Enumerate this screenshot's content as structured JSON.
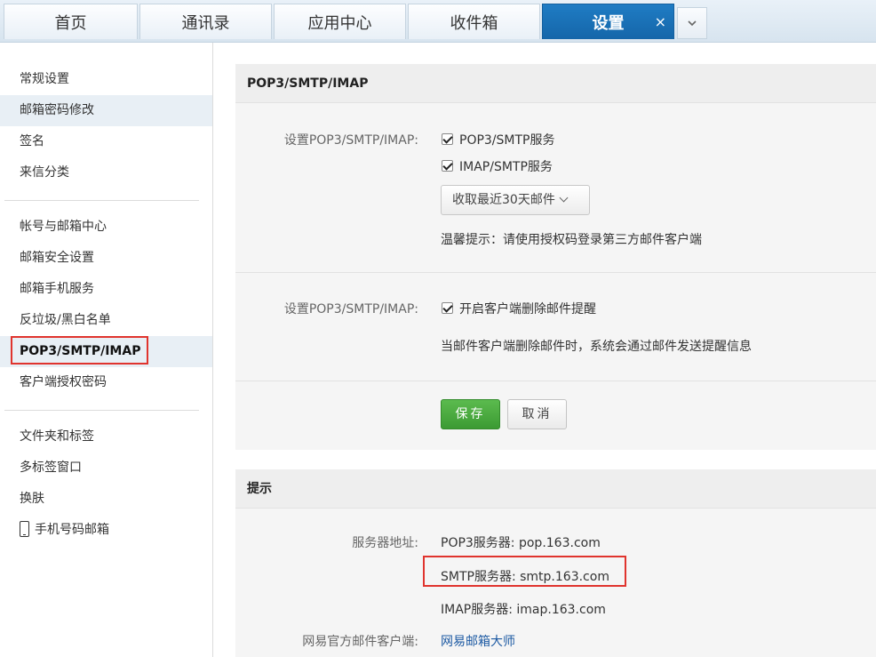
{
  "tabs": [
    {
      "label": "首页"
    },
    {
      "label": "通讯录"
    },
    {
      "label": "应用中心"
    },
    {
      "label": "收件箱"
    },
    {
      "label": "设置",
      "close": "×"
    }
  ],
  "tab_more_icon": "chevron-down-icon",
  "sidebar": {
    "group1": [
      "常规设置",
      "邮箱密码修改",
      "签名",
      "来信分类"
    ],
    "group2": [
      "帐号与邮箱中心",
      "邮箱安全设置",
      "邮箱手机服务",
      "反垃圾/黑白名单",
      "POP3/SMTP/IMAP",
      "客户端授权密码"
    ],
    "group3": [
      "文件夹和标签",
      "多标签窗口",
      "换肤",
      "手机号码邮箱"
    ]
  },
  "panel1": {
    "title": "POP3/SMTP/IMAP",
    "section1": {
      "label": "设置POP3/SMTP/IMAP:",
      "option1": "POP3/SMTP服务",
      "option2": "IMAP/SMTP服务",
      "select_value": "收取最近30天邮件",
      "tip": "温馨提示：请使用授权码登录第三方邮件客户端"
    },
    "section2": {
      "label": "设置POP3/SMTP/IMAP:",
      "option": "开启客户端删除邮件提醒",
      "desc": "当邮件客户端删除邮件时，系统会通过邮件发送提醒信息"
    },
    "save": "保存",
    "cancel": "取消"
  },
  "panel2": {
    "title": "提示",
    "server_label": "服务器地址:",
    "pop3": "POP3服务器: pop.163.com",
    "smtp": "SMTP服务器: smtp.163.com",
    "imap": "IMAP服务器: imap.163.com",
    "client_label": "网易官方邮件客户端:",
    "client_link": "网易邮箱大师"
  },
  "colors": {
    "active_tab": "#1566a9",
    "highlight_box": "#e0342e",
    "save_button": "#3c9a33",
    "link": "#1d5aa3"
  }
}
